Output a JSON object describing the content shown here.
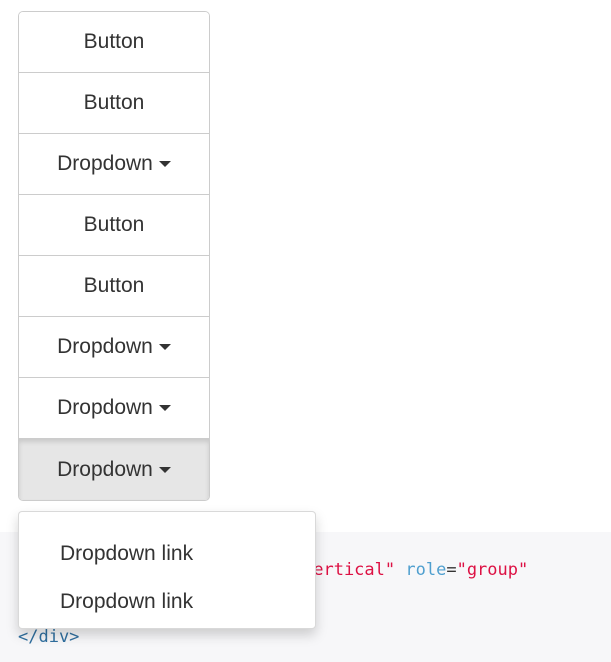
{
  "button_group": {
    "buttons": [
      {
        "label": "Button",
        "has_caret": false,
        "active": false
      },
      {
        "label": "Button",
        "has_caret": false,
        "active": false
      },
      {
        "label": "Dropdown",
        "has_caret": true,
        "active": false
      },
      {
        "label": "Button",
        "has_caret": false,
        "active": false
      },
      {
        "label": "Button",
        "has_caret": false,
        "active": false
      },
      {
        "label": "Dropdown",
        "has_caret": true,
        "active": false
      },
      {
        "label": "Dropdown",
        "has_caret": true,
        "active": false
      },
      {
        "label": "Dropdown",
        "has_caret": true,
        "active": true
      }
    ]
  },
  "dropdown_menu": {
    "items": [
      {
        "label": "Dropdown link"
      },
      {
        "label": "Dropdown link"
      }
    ]
  },
  "code": {
    "attr_value_fragment": "vertical\"",
    "attr_name": "role",
    "attr_eq": "=",
    "attr_value": "\"group\"",
    "closing_tag": "</div>"
  },
  "colors": {
    "border": "#cccccc",
    "text": "#333333",
    "active_bg": "#e6e6e6",
    "code_bg": "#f7f7f9",
    "code_string": "#dd1144",
    "code_attr": "#4f9fcf"
  }
}
